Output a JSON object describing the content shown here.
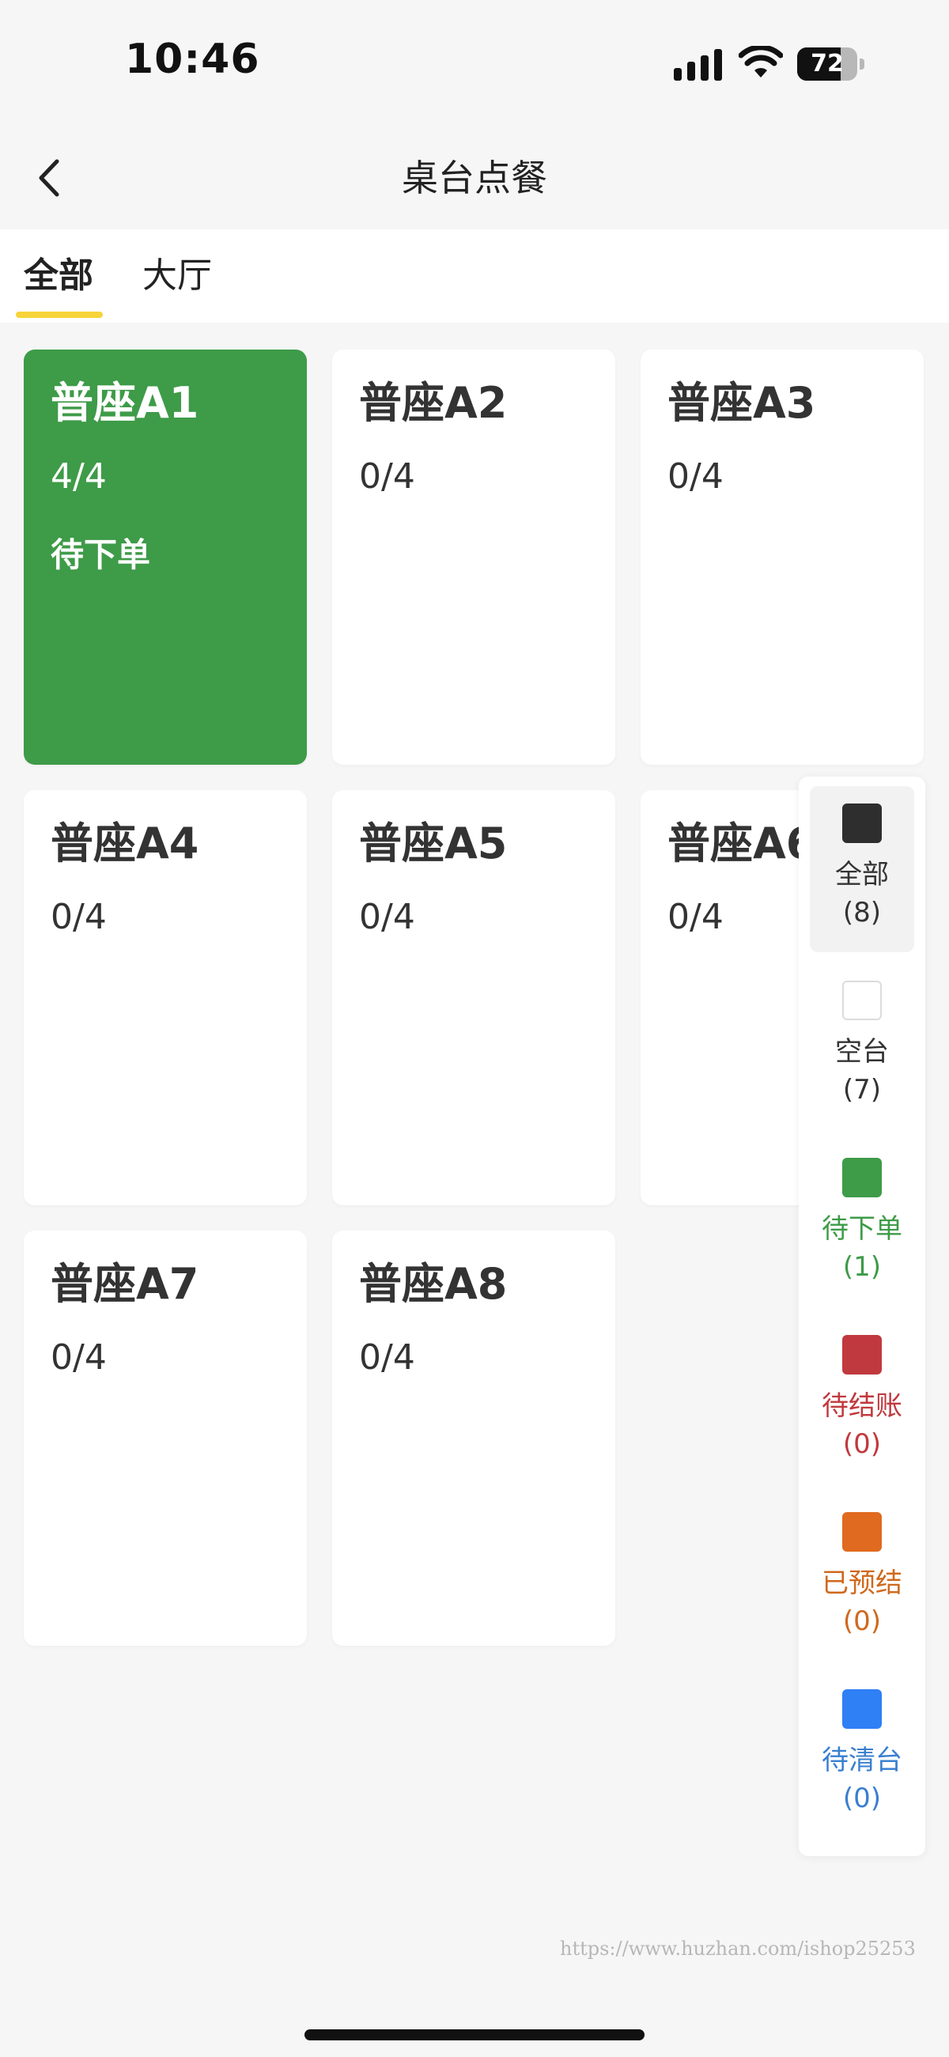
{
  "status_bar": {
    "time": "10:46",
    "battery_level": 72,
    "battery_label": "72",
    "icons": [
      "signal-icon",
      "wifi-icon",
      "battery-icon"
    ]
  },
  "nav": {
    "title": "桌台点餐",
    "back_icon": "chevron-left-icon"
  },
  "tabs": [
    {
      "label": "全部",
      "active": true
    },
    {
      "label": "大厅",
      "active": false
    }
  ],
  "tables": [
    {
      "name": "普座A1",
      "count": "4/4",
      "status": "待下单",
      "occupied": true
    },
    {
      "name": "普座A2",
      "count": "0/4",
      "status": "",
      "occupied": false
    },
    {
      "name": "普座A3",
      "count": "0/4",
      "status": "",
      "occupied": false
    },
    {
      "name": "普座A4",
      "count": "0/4",
      "status": "",
      "occupied": false
    },
    {
      "name": "普座A5",
      "count": "0/4",
      "status": "",
      "occupied": false
    },
    {
      "name": "普座A6",
      "count": "0/4",
      "status": "",
      "occupied": false
    },
    {
      "name": "普座A7",
      "count": "0/4",
      "status": "",
      "occupied": false
    },
    {
      "name": "普座A8",
      "count": "0/4",
      "status": "",
      "occupied": false
    }
  ],
  "legend": [
    {
      "label": "全部",
      "count": "(8)",
      "color": "#2e2e2e",
      "text_color": "#333333",
      "selected": true
    },
    {
      "label": "空台",
      "count": "(7)",
      "color": "#ffffff",
      "text_color": "#333333",
      "selected": false
    },
    {
      "label": "待下单",
      "count": "(1)",
      "color": "#3e9b48",
      "text_color": "#3e9b48",
      "selected": false
    },
    {
      "label": "待结账",
      "count": "(0)",
      "color": "#c0393e",
      "text_color": "#c0393e",
      "selected": false
    },
    {
      "label": "已预结",
      "count": "(0)",
      "color": "#e06a1f",
      "text_color": "#d0691e",
      "selected": false
    },
    {
      "label": "待清台",
      "count": "(0)",
      "color": "#2f7ff5",
      "text_color": "#3a7fd0",
      "selected": false
    }
  ],
  "watermark": "https://www.huzhan.com/ishop25253"
}
